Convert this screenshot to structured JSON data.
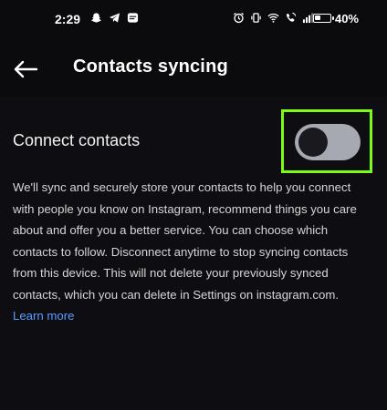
{
  "status_bar": {
    "time": "2:29",
    "battery_text": "40%",
    "battery_level": 0.4,
    "left_icons": [
      "snapchat-icon",
      "telegram-icon",
      "message-icon"
    ],
    "right_icons": [
      "alarm-icon",
      "vibrate-icon",
      "wifi-icon",
      "wifi-calling-icon",
      "signal-icon"
    ]
  },
  "header": {
    "title": "Contacts syncing",
    "back_icon": "arrow-left-icon"
  },
  "connect": {
    "label": "Connect contacts",
    "toggle_state": "off"
  },
  "description": {
    "text": "We'll sync and securely store your contacts to help you connect with people you know on Instagram, recommend things you care about and offer you a better service. You can choose which contacts to follow. Disconnect anytime to stop syncing contacts from this device. This will not delete your previously synced contacts, which you can delete in Settings on instagram.com.",
    "link": "Learn more"
  },
  "colors": {
    "background": "#0e0e12",
    "highlight": "#7cfb16",
    "link": "#5b9cff",
    "toggle_track": "#a7a9b2"
  }
}
